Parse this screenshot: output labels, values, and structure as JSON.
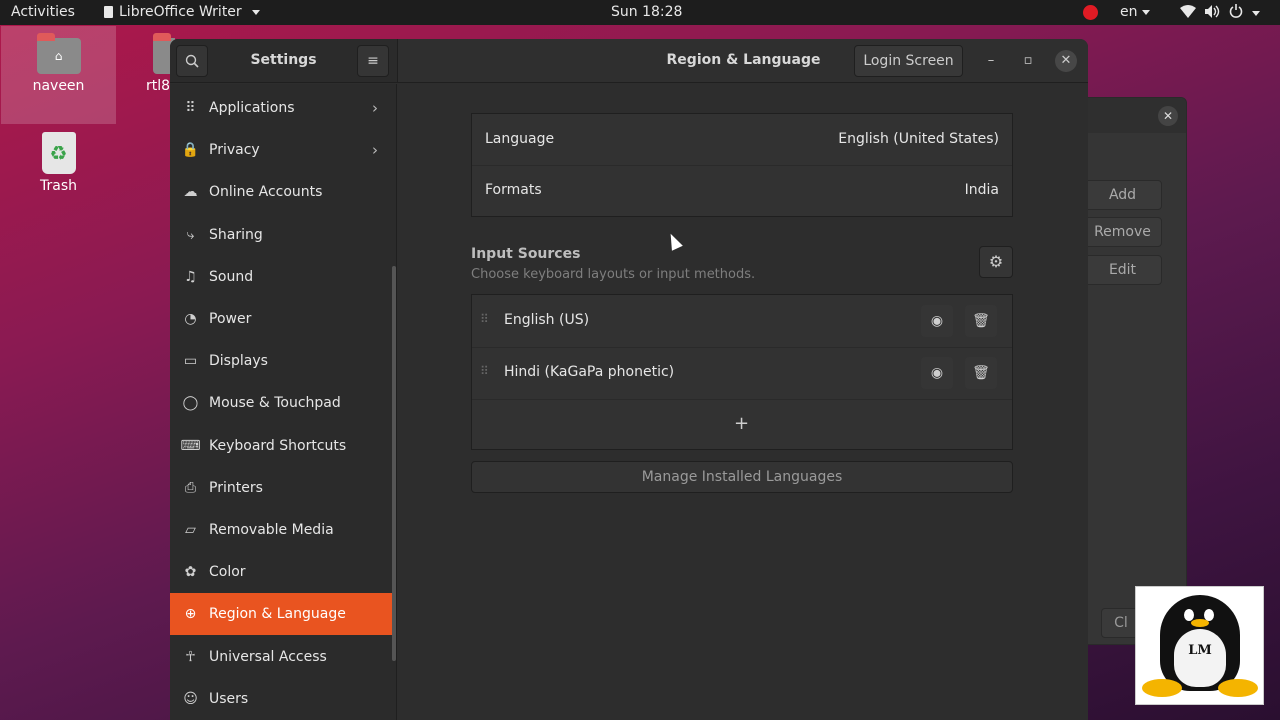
{
  "topbar": {
    "activities": "Activities",
    "app_name": "LibreOffice Writer",
    "clock": "Sun 18:28",
    "lang": "en"
  },
  "desktop": {
    "icons": [
      {
        "label": "naveen"
      },
      {
        "label": "rtl8"
      },
      {
        "label": "Trash"
      }
    ]
  },
  "bg_dialog": {
    "buttons": [
      "Add",
      "Remove",
      "Edit"
    ],
    "partial_button": "Cl"
  },
  "settings": {
    "sidebar_title": "Settings",
    "page_title": "Region & Language",
    "login_screen": "Login Screen",
    "sidebar_items": [
      {
        "label": "Applications",
        "icon": "applications-grid-icon",
        "glyph": "⠿",
        "chevron": true
      },
      {
        "label": "Privacy",
        "icon": "lock-icon",
        "glyph": "🔒",
        "chevron": true
      },
      {
        "label": "Online Accounts",
        "icon": "cloud-icon",
        "glyph": "☁"
      },
      {
        "label": "Sharing",
        "icon": "share-icon",
        "glyph": "⤷"
      },
      {
        "label": "Sound",
        "icon": "music-note-icon",
        "glyph": "♫"
      },
      {
        "label": "Power",
        "icon": "power-icon",
        "glyph": "◔"
      },
      {
        "label": "Displays",
        "icon": "display-icon",
        "glyph": "▭"
      },
      {
        "label": "Mouse & Touchpad",
        "icon": "mouse-icon",
        "glyph": "◯"
      },
      {
        "label": "Keyboard Shortcuts",
        "icon": "keyboard-icon",
        "glyph": "⌨"
      },
      {
        "label": "Printers",
        "icon": "printer-icon",
        "glyph": "⎙"
      },
      {
        "label": "Removable Media",
        "icon": "removable-media-icon",
        "glyph": "▱"
      },
      {
        "label": "Color",
        "icon": "color-icon",
        "glyph": "✿"
      },
      {
        "label": "Region & Language",
        "icon": "globe-icon",
        "glyph": "⊕",
        "active": true
      },
      {
        "label": "Universal Access",
        "icon": "accessibility-icon",
        "glyph": "☥"
      },
      {
        "label": "Users",
        "icon": "users-icon",
        "glyph": "☺"
      }
    ],
    "language_card": {
      "language_label": "Language",
      "language_value": "English (United States)",
      "formats_label": "Formats",
      "formats_value": "India"
    },
    "input_sources": {
      "title": "Input Sources",
      "subtitle": "Choose keyboard layouts or input methods.",
      "items": [
        "English (US)",
        "Hindi (KaGaPa phonetic)"
      ],
      "add": "+"
    },
    "manage_button": "Manage Installed Languages"
  },
  "logo": {
    "text": "LM"
  },
  "colors": {
    "accent": "#e95420",
    "panel": "#2d2d2d"
  }
}
